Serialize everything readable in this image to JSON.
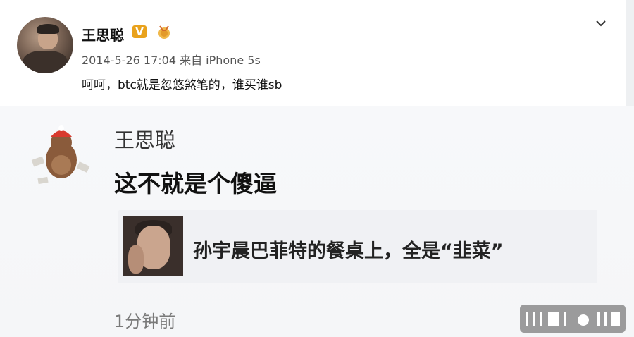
{
  "post": {
    "author": "王思聪",
    "verified_badge": "V",
    "meta": "2014-5-26 17:04 来自 iPhone 5s",
    "text": "呵呵，btc就是忽悠煞笔的，谁买谁sb"
  },
  "icons": {
    "verified": "verified-v-icon",
    "medal": "medal-icon",
    "menu": "chevron-down-icon"
  },
  "colors": {
    "verified_badge": "#e9a21c",
    "background": "#ffffff",
    "comment_bg": "#f6f7f9"
  },
  "comment": {
    "author": "王思聪",
    "text": "这不就是个傻逼",
    "quote_text": "孙宇晨巴菲特的餐桌上，全是“韭菜”",
    "time": "1分钟前"
  }
}
